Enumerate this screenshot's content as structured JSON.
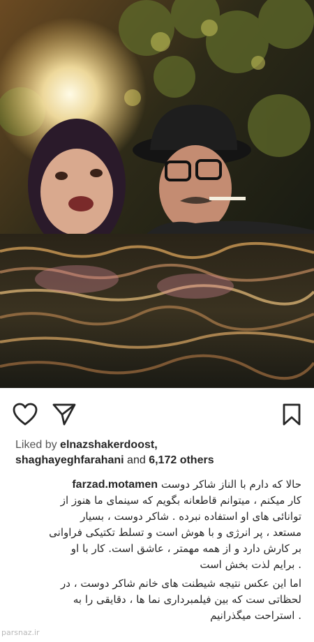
{
  "post": {
    "photo": {
      "description_icon": "photo"
    },
    "actions": {
      "like_icon": "heart-icon",
      "share_icon": "send-icon",
      "save_icon": "bookmark-icon"
    },
    "likes": {
      "prefix": "Liked by",
      "user1": "elnazshakerdoost,",
      "user2": "shaghayeghfarahani",
      "middle": " and ",
      "count": "6,172 others"
    },
    "caption": {
      "username": "farzad.motamen",
      "line1": "حالا که دارم با الناز شاکر دوست",
      "lines": [
        "کار میکنم ، میتوانم قاطعانه بگویم که سینمای ما هنوز از",
        "توانائی های او استفاده نبرده . شاکر دوست ، بسیار",
        "مستعد ، پر انرژی و با هوش است و تسلط تکتیکی فراوانی",
        "بر کارش دارد و از همه مهمتر ، عاشق است. کار با او",
        ". برایم لذت بخش است",
        "اما این عکس نتیجه شیطنت های خانم شاکر دوست ، در",
        "لحظاتی ست که بین فیلمبرداری نما ها ، دقایقی را به",
        ". استراحت میگذرانیم"
      ]
    },
    "watermark": "parsnaz.ir"
  }
}
